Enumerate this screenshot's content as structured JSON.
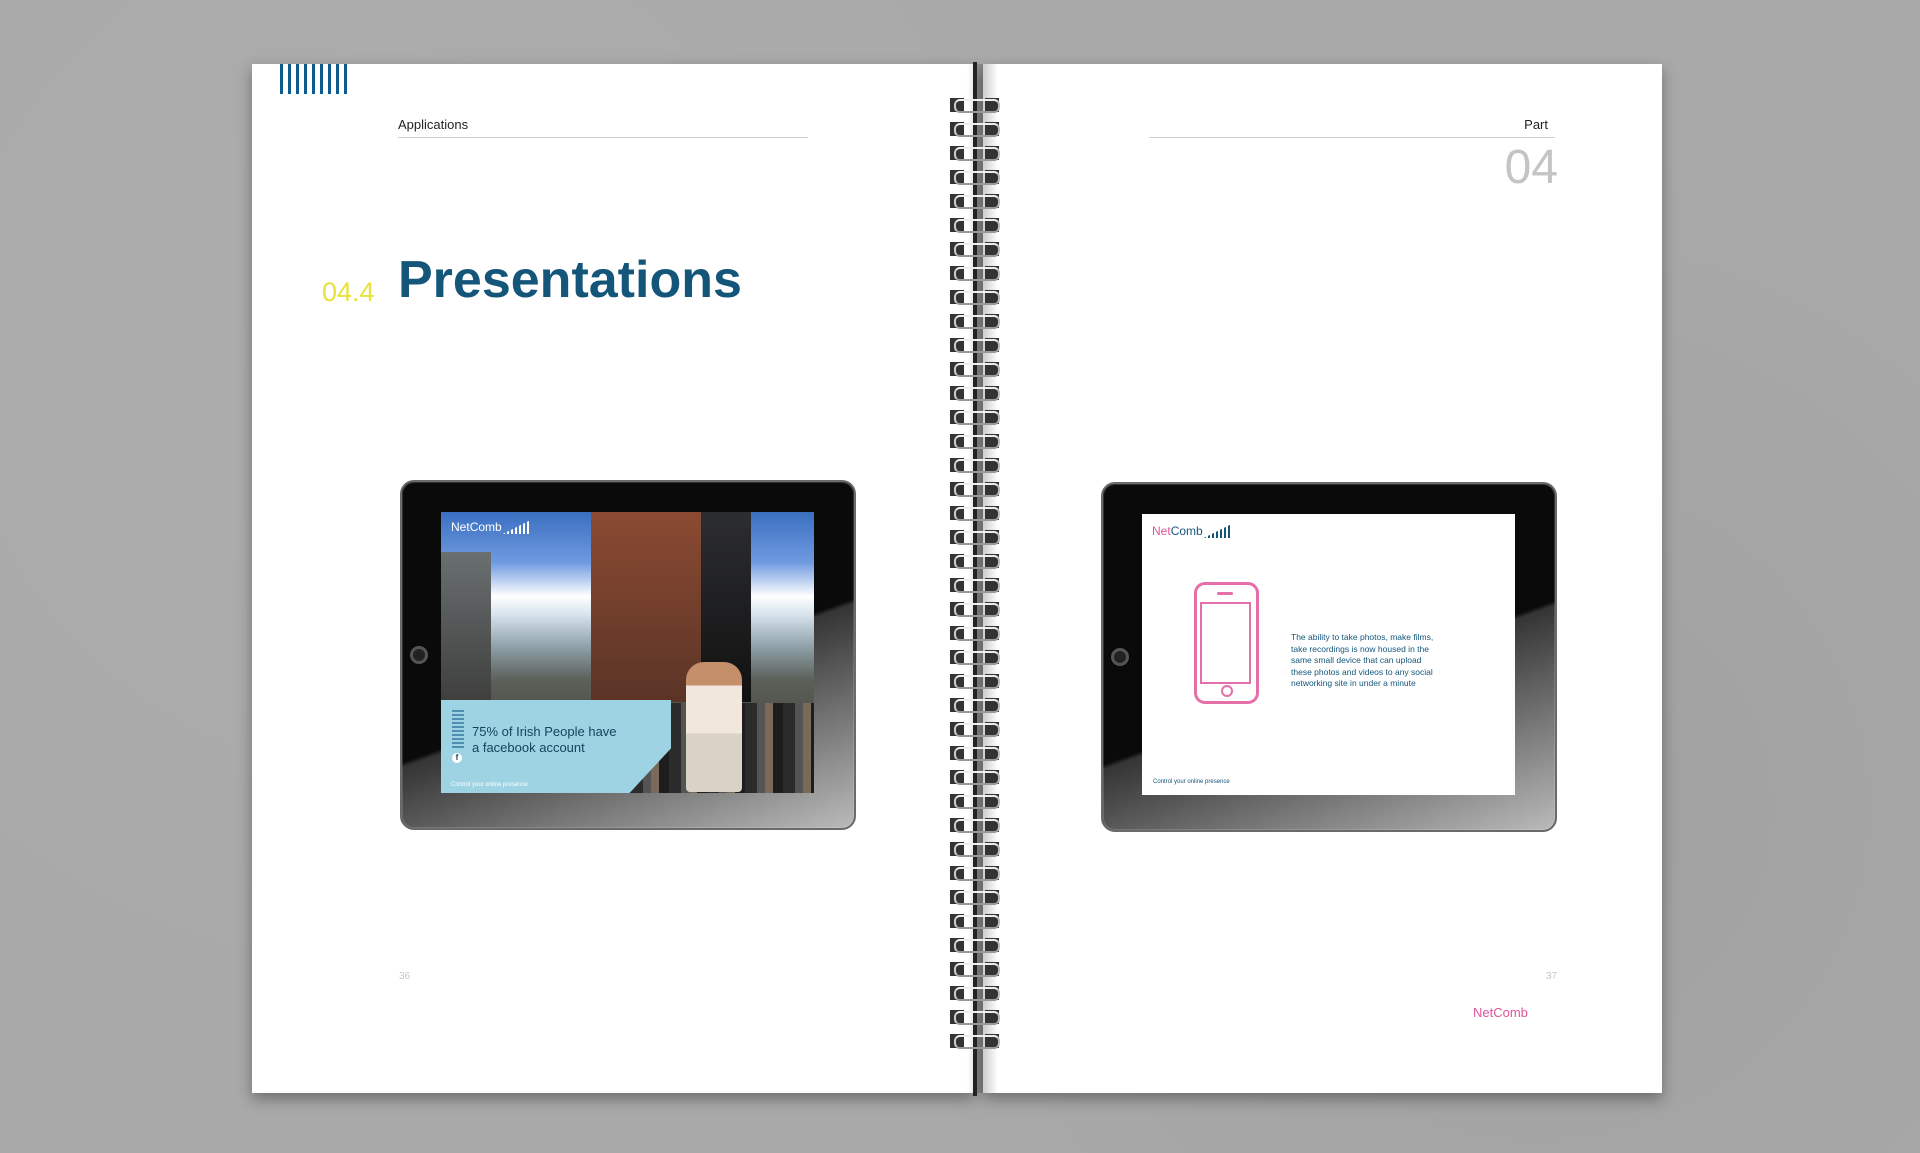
{
  "left_page": {
    "running_head": "Applications",
    "section_number": "04.4",
    "section_title": "Presentations",
    "page_number": "36"
  },
  "right_page": {
    "running_head": "Part",
    "part_number": "04",
    "page_number": "37",
    "footer_logo": {
      "net": "Net",
      "comb": "Comb"
    }
  },
  "left_slide": {
    "logo": {
      "net": "Net",
      "comb": "Comb"
    },
    "headline_line1": "75% of Irish People have",
    "headline_line2": "a facebook account",
    "facebook_glyph": "f",
    "tagline": "Control your online presence"
  },
  "right_slide": {
    "logo": {
      "net": "Net",
      "comb": "Comb"
    },
    "body_lines": [
      "The ability to take photos, make films,",
      "take recordings is now housed in the",
      "same small device that can upload",
      "these photos and videos to any social",
      "networking site in under a minute"
    ],
    "tagline": "Control your online presence"
  },
  "colors": {
    "brand_blue": "#14567a",
    "accent_yellow": "#e8e23a",
    "brand_pink": "#e0559a",
    "panel_cyan": "#9dd3e3"
  }
}
